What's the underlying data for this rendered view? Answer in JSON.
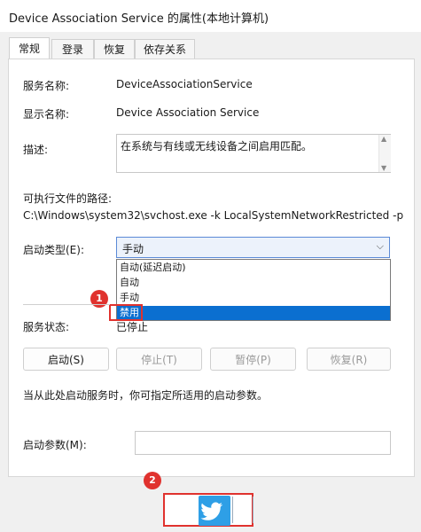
{
  "window": {
    "title": "Device Association Service 的属性(本地计算机)"
  },
  "tabs": [
    {
      "label": "常规"
    },
    {
      "label": "登录"
    },
    {
      "label": "恢复"
    },
    {
      "label": "依存关系"
    }
  ],
  "general": {
    "service_name_label": "服务名称:",
    "service_name_value": "DeviceAssociationService",
    "display_name_label": "显示名称:",
    "display_name_value": "Device Association Service",
    "description_label": "描述:",
    "description_value": "在系统与有线或无线设备之间启用匹配。",
    "exe_path_label": "可执行文件的路径:",
    "exe_path_value": "C:\\Windows\\system32\\svchost.exe -k LocalSystemNetworkRestricted -p",
    "startup_type_label": "启动类型(E):",
    "startup_type_value": "手动",
    "startup_options": [
      "自动(延迟启动)",
      "自动",
      "手动",
      "禁用"
    ],
    "highlighted_option": "禁用",
    "service_status_label": "服务状态:",
    "service_status_value": "已停止",
    "buttons": {
      "start": "启动(S)",
      "stop": "停止(T)",
      "pause": "暂停(P)",
      "resume": "恢复(R)"
    },
    "hint": "当从此处启动服务时，你可指定所适用的启动参数。",
    "start_params_label": "启动参数(M):",
    "start_params_value": ""
  },
  "annotations": {
    "badge1": "1",
    "badge2": "2"
  },
  "colors": {
    "accent": "#0b6fd0",
    "highlight": "#e0322e",
    "twitter": "#2e9fe6"
  }
}
